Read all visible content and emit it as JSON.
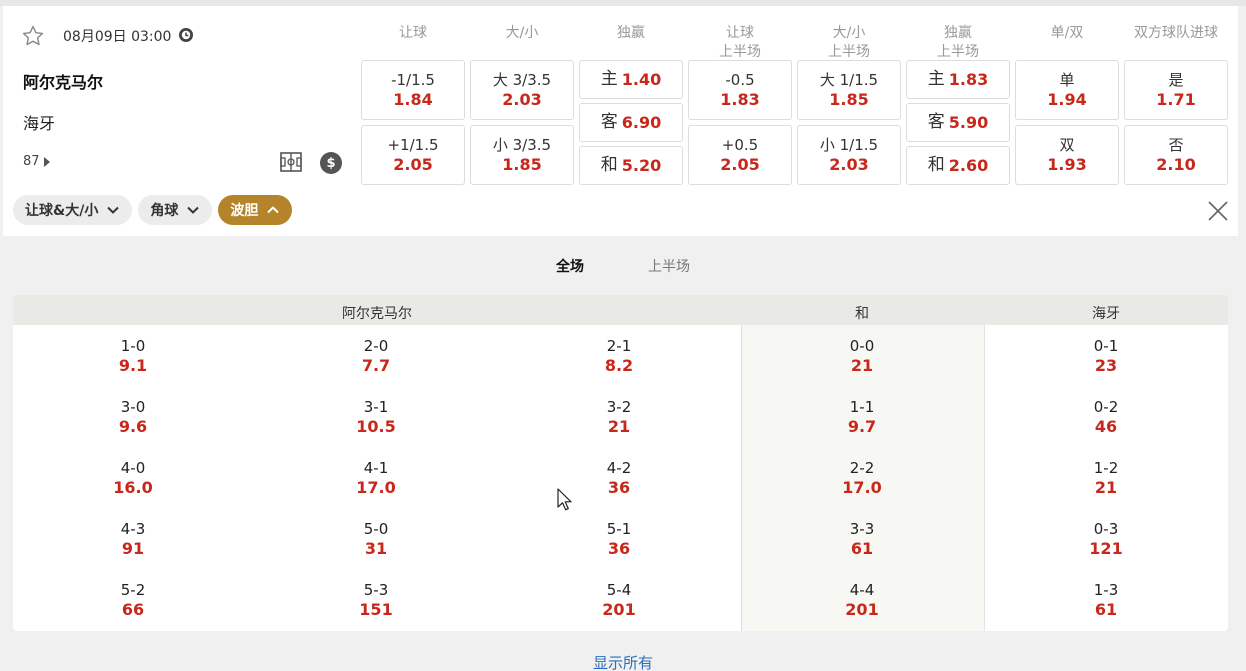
{
  "match": {
    "datetime": "08月09日 03:00",
    "home_team": "阿尔克马尔",
    "away_team": "海牙",
    "more_markets_count": "87"
  },
  "column_headers": [
    {
      "line1": "让球",
      "line2": ""
    },
    {
      "line1": "大/小",
      "line2": ""
    },
    {
      "line1": "独赢",
      "line2": ""
    },
    {
      "line1": "让球",
      "line2": "上半场"
    },
    {
      "line1": "大/小",
      "line2": "上半场"
    },
    {
      "line1": "独赢",
      "line2": "上半场"
    },
    {
      "line1": "单/双",
      "line2": ""
    },
    {
      "line1": "双方球队进球",
      "line2": ""
    }
  ],
  "odds": {
    "handicap": [
      {
        "label": "-1/1.5",
        "value": "1.84"
      },
      {
        "label": "+1/1.5",
        "value": "2.05"
      }
    ],
    "total": [
      {
        "label": "大 3/3.5",
        "value": "2.03"
      },
      {
        "label": "小 3/3.5",
        "value": "1.85"
      }
    ],
    "moneyline": [
      {
        "label": "主",
        "value": "1.40"
      },
      {
        "label": "客",
        "value": "6.90"
      },
      {
        "label": "和",
        "value": "5.20"
      }
    ],
    "handicap_1h": [
      {
        "label": "-0.5",
        "value": "1.83"
      },
      {
        "label": "+0.5",
        "value": "2.05"
      }
    ],
    "total_1h": [
      {
        "label": "大 1/1.5",
        "value": "1.85"
      },
      {
        "label": "小 1/1.5",
        "value": "2.03"
      }
    ],
    "moneyline_1h": [
      {
        "label": "主",
        "value": "1.83"
      },
      {
        "label": "客",
        "value": "5.90"
      },
      {
        "label": "和",
        "value": "2.60"
      }
    ],
    "odd_even": [
      {
        "label": "单",
        "value": "1.94"
      },
      {
        "label": "双",
        "value": "1.93"
      }
    ],
    "btts": [
      {
        "label": "是",
        "value": "1.71"
      },
      {
        "label": "否",
        "value": "2.10"
      }
    ]
  },
  "chips": [
    {
      "label": "让球&大/小",
      "active": false
    },
    {
      "label": "角球",
      "active": false
    },
    {
      "label": "波胆",
      "active": true
    }
  ],
  "tabs": [
    {
      "label": "全场",
      "active": true
    },
    {
      "label": "上半场",
      "active": false
    }
  ],
  "score_table": {
    "headers": {
      "home": "阿尔克马尔",
      "draw": "和",
      "away": "海牙"
    },
    "home_cols": [
      [
        {
          "score": "1-0",
          "odds": "9.1"
        },
        {
          "score": "3-0",
          "odds": "9.6"
        },
        {
          "score": "4-0",
          "odds": "16.0"
        },
        {
          "score": "4-3",
          "odds": "91"
        },
        {
          "score": "5-2",
          "odds": "66"
        }
      ],
      [
        {
          "score": "2-0",
          "odds": "7.7"
        },
        {
          "score": "3-1",
          "odds": "10.5"
        },
        {
          "score": "4-1",
          "odds": "17.0"
        },
        {
          "score": "5-0",
          "odds": "31"
        },
        {
          "score": "5-3",
          "odds": "151"
        }
      ],
      [
        {
          "score": "2-1",
          "odds": "8.2"
        },
        {
          "score": "3-2",
          "odds": "21"
        },
        {
          "score": "4-2",
          "odds": "36"
        },
        {
          "score": "5-1",
          "odds": "36"
        },
        {
          "score": "5-4",
          "odds": "201"
        }
      ]
    ],
    "draw_col": [
      {
        "score": "0-0",
        "odds": "21"
      },
      {
        "score": "1-1",
        "odds": "9.7"
      },
      {
        "score": "2-2",
        "odds": "17.0"
      },
      {
        "score": "3-3",
        "odds": "61"
      },
      {
        "score": "4-4",
        "odds": "201"
      }
    ],
    "away_col": [
      {
        "score": "0-1",
        "odds": "23"
      },
      {
        "score": "0-2",
        "odds": "46"
      },
      {
        "score": "1-2",
        "odds": "21"
      },
      {
        "score": "0-3",
        "odds": "121"
      },
      {
        "score": "1-3",
        "odds": "61"
      }
    ]
  },
  "show_all_label": "显示所有",
  "colors": {
    "odds_red": "#c8281b",
    "active_chip": "#b5842a",
    "link_blue": "#2a6ebb"
  }
}
